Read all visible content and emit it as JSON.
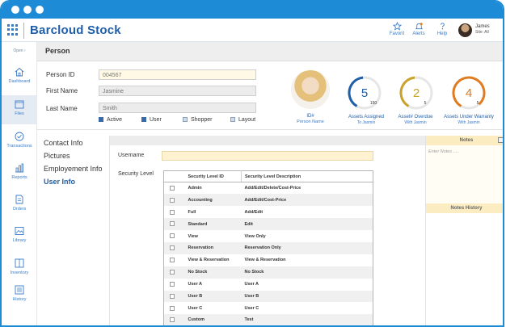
{
  "app": {
    "title": "Barcloud Stock"
  },
  "header": {
    "favorites_label": "Favorit",
    "alerts_label": "Alerts",
    "help_label": "Help",
    "user_name": "James",
    "user_site": "Site:  All"
  },
  "sidebar": {
    "collapse_label": "Open  ›",
    "items": [
      {
        "label": "Dashboard",
        "icon": "home-icon"
      },
      {
        "label": "Files",
        "icon": "files-icon",
        "active": true
      },
      {
        "label": "Transactions",
        "icon": "transactions-icon"
      },
      {
        "label": "Reports",
        "icon": "reports-icon"
      },
      {
        "label": "Orders",
        "icon": "orders-icon"
      },
      {
        "label": "Library",
        "icon": "library-icon"
      },
      {
        "label": "Inventory",
        "icon": "inventory-icon"
      },
      {
        "label": "History",
        "icon": "history-icon"
      }
    ]
  },
  "page": {
    "title": "Person"
  },
  "person": {
    "id_label": "Person ID",
    "id_value": "004567",
    "first_name_label": "First Name",
    "first_name_value": "Jasmine",
    "last_name_label": "Last Name",
    "last_name_value": "Smith",
    "checkboxes": [
      {
        "label": "Active",
        "checked": true
      },
      {
        "label": "User",
        "checked": true
      },
      {
        "label": "Shopper",
        "checked": false
      },
      {
        "label": "Layout",
        "checked": false
      }
    ],
    "photo_id_label": "ID#",
    "photo_sub_label": "Person Name"
  },
  "gauges": [
    {
      "value": "5",
      "denominator": "150",
      "fraction": 0.4,
      "color": "#1f5ea8",
      "caption": "Assets Assigned",
      "sub": "To Jasmin"
    },
    {
      "value": "2",
      "denominator": "5",
      "fraction": 0.4,
      "color": "#c9a227",
      "caption": "Asset# Overdue",
      "sub": "With Jasmin"
    },
    {
      "value": "4",
      "denominator": "5",
      "fraction": 0.8,
      "color": "#e07b1f",
      "caption": "Assets Under Warranty",
      "sub": "With Jasmin"
    }
  ],
  "tabs": [
    {
      "label": "Contact Info",
      "active": false
    },
    {
      "label": "Pictures",
      "active": false
    },
    {
      "label": "Employement Info",
      "active": false
    },
    {
      "label": "User Info",
      "active": true
    }
  ],
  "user_info": {
    "username_label": "Username",
    "username_value": "",
    "security_label": "Security Level",
    "table_headers": [
      "Security Level ID",
      "Security Level Description"
    ],
    "rows": [
      {
        "id": "Admin",
        "desc": "Add/Edit/Delete/Cost-Price"
      },
      {
        "id": "Accounting",
        "desc": "Add/Edit/Cost-Price"
      },
      {
        "id": "Full",
        "desc": "Add/Edit"
      },
      {
        "id": "Standard",
        "desc": "Edit"
      },
      {
        "id": "View",
        "desc": "View Only"
      },
      {
        "id": "Reservation",
        "desc": "Reservation Only"
      },
      {
        "id": "View & Reservation",
        "desc": "View & Reservation"
      },
      {
        "id": "No Stock",
        "desc": "No Stock"
      },
      {
        "id": "User A",
        "desc": "User A"
      },
      {
        "id": "User B",
        "desc": "User B"
      },
      {
        "id": "User C",
        "desc": "User C"
      },
      {
        "id": "Custom",
        "desc": "Test"
      }
    ]
  },
  "notes": {
    "title": "Notes",
    "placeholder": "Enter Notes .....",
    "history_title": "Notes History"
  }
}
